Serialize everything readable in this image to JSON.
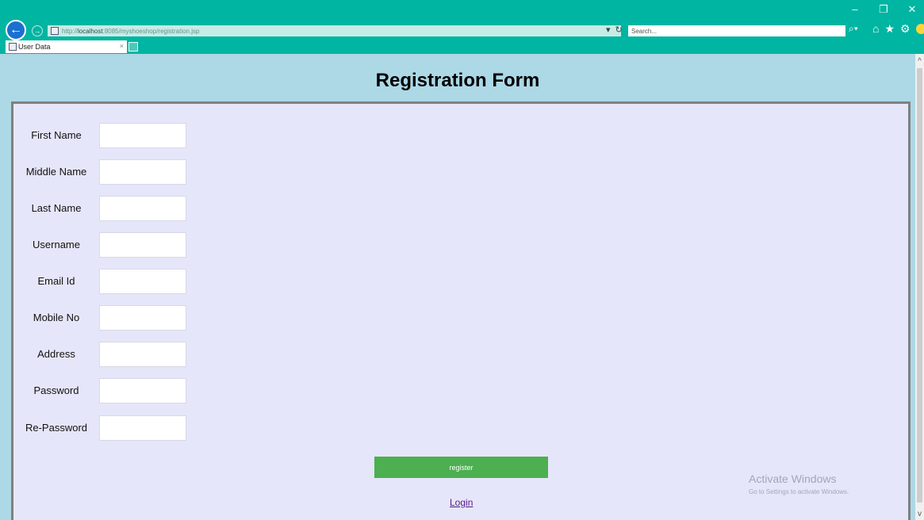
{
  "browser": {
    "url_prefix": "http://",
    "url_host": "localhost",
    "url_rest": ":8085/myshoeshop/registration.jsp",
    "search_placeholder": "Search...",
    "tab_title": "User Data",
    "tab_close": "×",
    "window_minimize": "–",
    "window_restore": "❐",
    "window_close": "✕"
  },
  "page": {
    "title": "Registration Form"
  },
  "form": {
    "fields": [
      {
        "label": "First Name",
        "value": ""
      },
      {
        "label": "Middle Name",
        "value": ""
      },
      {
        "label": "Last Name",
        "value": ""
      },
      {
        "label": "Username",
        "value": ""
      },
      {
        "label": "Email Id",
        "value": ""
      },
      {
        "label": "Mobile No",
        "value": ""
      },
      {
        "label": "Address",
        "value": ""
      },
      {
        "label": "Password",
        "value": ""
      },
      {
        "label": "Re-Password",
        "value": ""
      }
    ],
    "register_label": "register",
    "login_label": "Login"
  },
  "watermark": {
    "line1": "Activate Windows",
    "line2": "Go to Settings to activate Windows."
  },
  "colors": {
    "chrome": "#00b5a2",
    "page_background": "#add8e6",
    "form_background": "#e6e6fa",
    "button": "#4caf50",
    "link": "#551a8b"
  },
  "icons": [
    "back-arrow-icon",
    "forward-arrow-icon",
    "page-favicon-icon",
    "dropdown-arrow-icon",
    "refresh-icon",
    "search-icon",
    "home-icon",
    "favorites-star-icon",
    "settings-gear-icon",
    "feedback-smiley-icon",
    "new-tab-icon",
    "scroll-up-icon",
    "scroll-down-icon"
  ]
}
